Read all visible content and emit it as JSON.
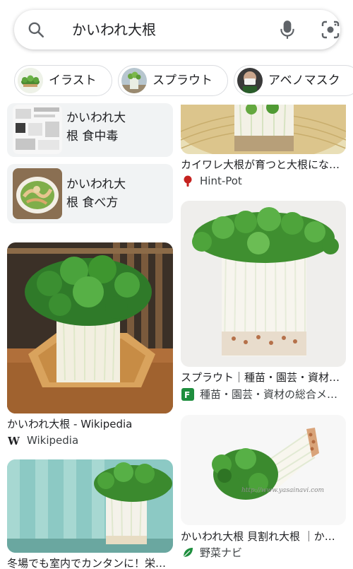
{
  "search": {
    "query": "かいわれ大根"
  },
  "chips": [
    {
      "label": "イラスト"
    },
    {
      "label": "スプラウト"
    },
    {
      "label": "アベノマスク"
    }
  ],
  "left_column": {
    "mini_1": {
      "label": "かいわれ大根 食中毒"
    },
    "mini_2": {
      "label": "かいわれ大根 食べ方"
    },
    "card_1": {
      "title": "かいわれ大根 - Wikipedia",
      "source": "Wikipedia"
    },
    "card_2": {
      "title": "冬場でも室内でカンタンに！栄…"
    }
  },
  "right_column": {
    "card_1": {
      "title": "カイワレ大根が育つと大根にな…",
      "source": "Hint-Pot"
    },
    "card_2": {
      "title": "スプラウト｜種苗・園芸・資材…",
      "source": "種苗・園芸・資材の総合メ…"
    },
    "card_3": {
      "title": "かいわれ大根 貝割れ大根 ｜か…",
      "source": "野菜ナビ",
      "watermark": "http://www.yasainavi.com"
    }
  },
  "colors": {
    "accent_red": "#c5221f",
    "favicon_green": "#1e8e3e",
    "chip_border": "#dadce0"
  }
}
